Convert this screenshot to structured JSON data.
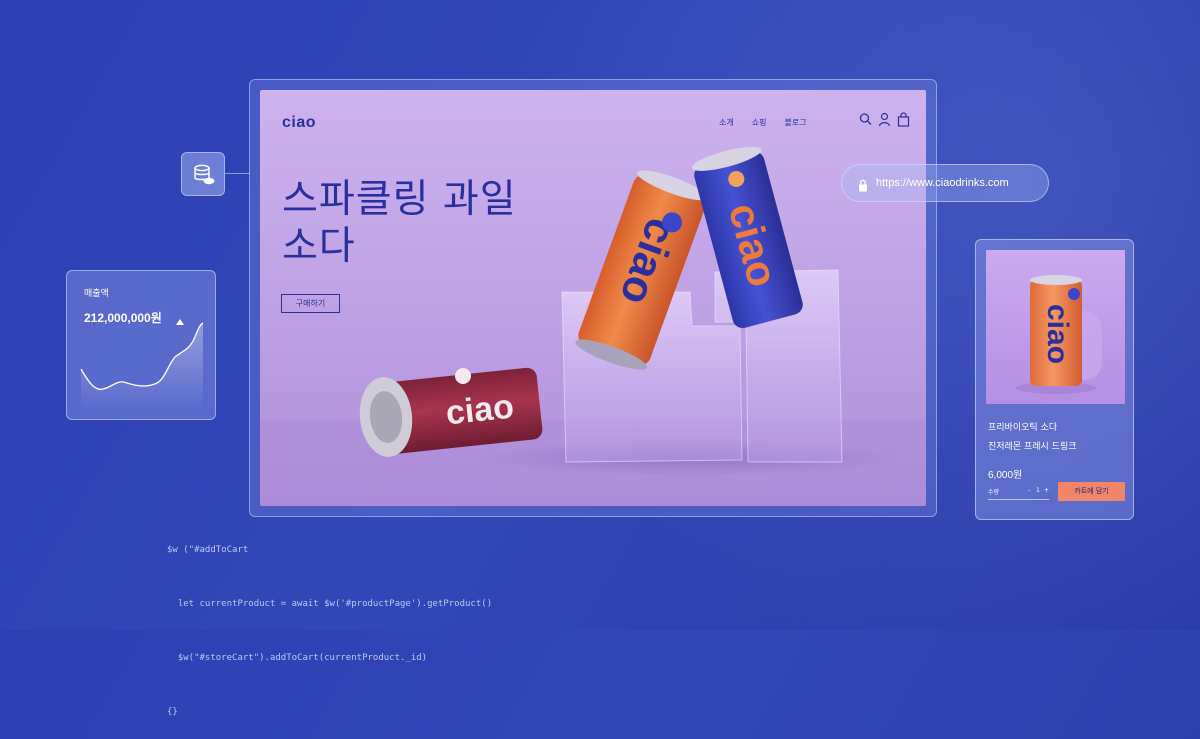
{
  "site": {
    "logo": "ciao",
    "nav": [
      "소개",
      "쇼핑",
      "블로그"
    ],
    "nav_icons": [
      "search-icon",
      "user-icon",
      "bag-icon"
    ],
    "hero_title_line1": "스파클링 과일",
    "hero_title_line2": "소다",
    "cta_label": "구매하기",
    "can_brand": "ciao"
  },
  "url_bar": {
    "url": "https://www.ciaodrinks.com",
    "icon": "lock-icon"
  },
  "database_widget": {
    "icon": "database-icon"
  },
  "revenue_card": {
    "label": "매출액",
    "value": "212,000,000원",
    "trend_icon": "triangle-up-icon"
  },
  "product_card": {
    "name": "프리바이오틱 소다",
    "description": "진저레몬 프레시 드링크",
    "price": "6,000원",
    "quantity_label": "수량",
    "quantity_minus": "-",
    "quantity_value": "1",
    "quantity_plus": "+",
    "add_to_cart": "카트에 담기",
    "can_brand": "ciao"
  },
  "code_snippet": [
    "$w (\"#addToCart",
    "  let currentProduct = await $w('#productPage').getProduct()",
    "  $w(\"#storeCart\").addToCart(currentProduct._id)",
    "{}"
  ],
  "colors": {
    "background": "#3043b3",
    "brand_navy": "#2a2f9e",
    "site_lilac": "#c4a8ea",
    "orange_can": "#ee7a3c",
    "blue_can": "#3c46c9",
    "maroon_can": "#9a2e4a",
    "cart_button": "#f0856a"
  }
}
